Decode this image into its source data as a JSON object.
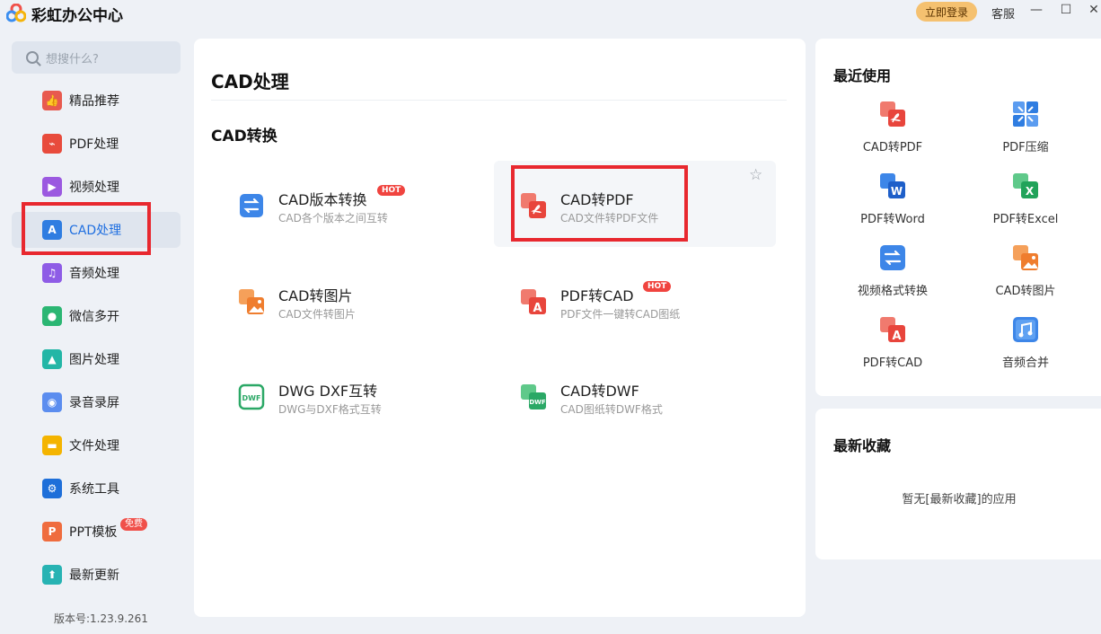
{
  "app": {
    "title": "彩虹办公中心",
    "login_label": "立即登录",
    "service_label": "客服",
    "minimize_glyph": "—",
    "maximize_glyph": "☐",
    "close_glyph": "✕"
  },
  "sidebar": {
    "search_placeholder": "想搜什么?",
    "items": [
      {
        "label": "精品推荐",
        "icon": "thumbs-up-icon",
        "color": "#e85a4f"
      },
      {
        "label": "PDF处理",
        "icon": "pdf-icon",
        "color": "#e84b3c"
      },
      {
        "label": "视频处理",
        "icon": "play-icon",
        "color": "#9b59e0"
      },
      {
        "label": "CAD处理",
        "icon": "cad-icon",
        "color": "#2f7de1",
        "active": true
      },
      {
        "label": "音频处理",
        "icon": "music-icon",
        "color": "#8e5ce6"
      },
      {
        "label": "微信多开",
        "icon": "wechat-icon",
        "color": "#2bb673"
      },
      {
        "label": "图片处理",
        "icon": "image-icon",
        "color": "#23b6a6"
      },
      {
        "label": "录音录屏",
        "icon": "mic-icon",
        "color": "#5b8def"
      },
      {
        "label": "文件处理",
        "icon": "folder-icon",
        "color": "#f4b400"
      },
      {
        "label": "系统工具",
        "icon": "gear-icon",
        "color": "#1e6fd9"
      },
      {
        "label": "PPT模板",
        "icon": "ppt-icon",
        "color": "#ef6c3e",
        "badge": "免费"
      },
      {
        "label": "最新更新",
        "icon": "upload-icon",
        "color": "#27b3b3"
      }
    ],
    "version": "版本号:1.23.9.261"
  },
  "main": {
    "title": "CAD处理",
    "section": "CAD转换",
    "tools": [
      {
        "name": "CAD版本转换",
        "desc": "CAD各个版本之间互转",
        "icon": "swap-icon",
        "hot": "HOT"
      },
      {
        "name": "CAD转PDF",
        "desc": "CAD文件转PDF文件",
        "icon": "cad-to-pdf-icon",
        "hot": ""
      },
      {
        "name": "CAD转图片",
        "desc": "CAD文件转图片",
        "icon": "cad-to-image-icon",
        "hot": ""
      },
      {
        "name": "PDF转CAD",
        "desc": "PDF文件一键转CAD图纸",
        "icon": "pdf-to-cad-icon",
        "hot": "HOT"
      },
      {
        "name": "DWG DXF互转",
        "desc": "DWG与DXF格式互转",
        "icon": "dwg-dxf-icon",
        "hot": ""
      },
      {
        "name": "CAD转DWF",
        "desc": "CAD图纸转DWF格式",
        "icon": "cad-to-dwf-icon",
        "hot": ""
      }
    ]
  },
  "recent": {
    "title": "最近使用",
    "items": [
      {
        "label": "CAD转PDF",
        "icon": "cad-to-pdf-icon"
      },
      {
        "label": "PDF压缩",
        "icon": "compress-icon"
      },
      {
        "label": "PDF转Word",
        "icon": "pdf-to-word-icon"
      },
      {
        "label": "PDF转Excel",
        "icon": "pdf-to-excel-icon"
      },
      {
        "label": "视频格式转换",
        "icon": "video-convert-icon"
      },
      {
        "label": "CAD转图片",
        "icon": "cad-to-image-icon"
      },
      {
        "label": "PDF转CAD",
        "icon": "pdf-to-cad-icon"
      },
      {
        "label": "音频合并",
        "icon": "audio-merge-icon"
      }
    ]
  },
  "favorites": {
    "title": "最新收藏",
    "empty_text": "暂无[最新收藏]的应用"
  },
  "colors": {
    "accent": "#1f6fe0",
    "highlight_frame": "#e8282f",
    "login_button": "#f5c170"
  }
}
